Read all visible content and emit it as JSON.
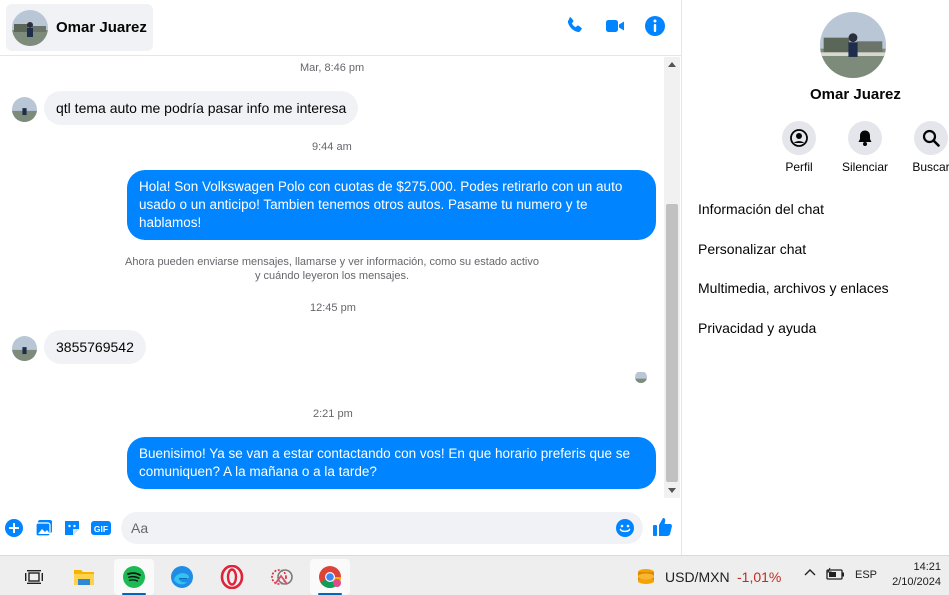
{
  "contact": {
    "name": "Omar Juarez"
  },
  "colors": {
    "accent": "#0084ff",
    "bubble_in": "#f0f2f5",
    "negative": "#c42b1c"
  },
  "header": {
    "icons": [
      "phone-icon",
      "video-camera-icon",
      "info-icon"
    ]
  },
  "messages": {
    "stamp1": "Mar, 8:46 pm",
    "msg1": "qtl tema auto me podría pasar info  me interesa",
    "stamp2": "9:44 am",
    "msg2": "Hola! Son Volkswagen Polo con cuotas de $275.000. Podes retirarlo con un auto usado o un anticipo! Tambien tenemos otros autos. Pasame tu numero y te hablamos!",
    "notice_line1": "Ahora pueden enviarse mensajes, llamarse y ver información, como su estado activo",
    "notice_line2": "y cuándo leyeron los mensajes.",
    "stamp3": "12:45 pm",
    "msg3": "3855769542",
    "stamp4": "2:21 pm",
    "msg4": "Buenisimo! Ya se van a estar contactando con vos! En que horario preferis que se comuniquen? A la mañana o a la tarde?"
  },
  "composer": {
    "placeholder": "Aa",
    "icons": [
      "plus-icon",
      "photo-icon",
      "sticker-icon",
      "gif-icon",
      "emoji-icon",
      "thumbs-up-icon"
    ],
    "gif_label": "GIF"
  },
  "info_panel": {
    "name": "Omar Juarez",
    "actions": [
      {
        "label": "Perfil",
        "icon": "profile-icon"
      },
      {
        "label": "Silenciar",
        "icon": "bell-icon"
      },
      {
        "label": "Buscar",
        "icon": "search-icon"
      }
    ],
    "menu": [
      "Información del chat",
      "Personalizar chat",
      "Multimedia, archivos y enlaces",
      "Privacidad y ayuda"
    ]
  },
  "taskbar": {
    "apps": [
      "task-view-icon",
      "file-explorer-icon",
      "spotify-icon",
      "edge-icon",
      "opera-icon",
      "snipping-tool-icon",
      "chrome-icon"
    ],
    "ticker": "USD/MXN",
    "change": "-1,01%",
    "lang": "ESP",
    "time": "14:21",
    "date": "2/10/2024"
  }
}
